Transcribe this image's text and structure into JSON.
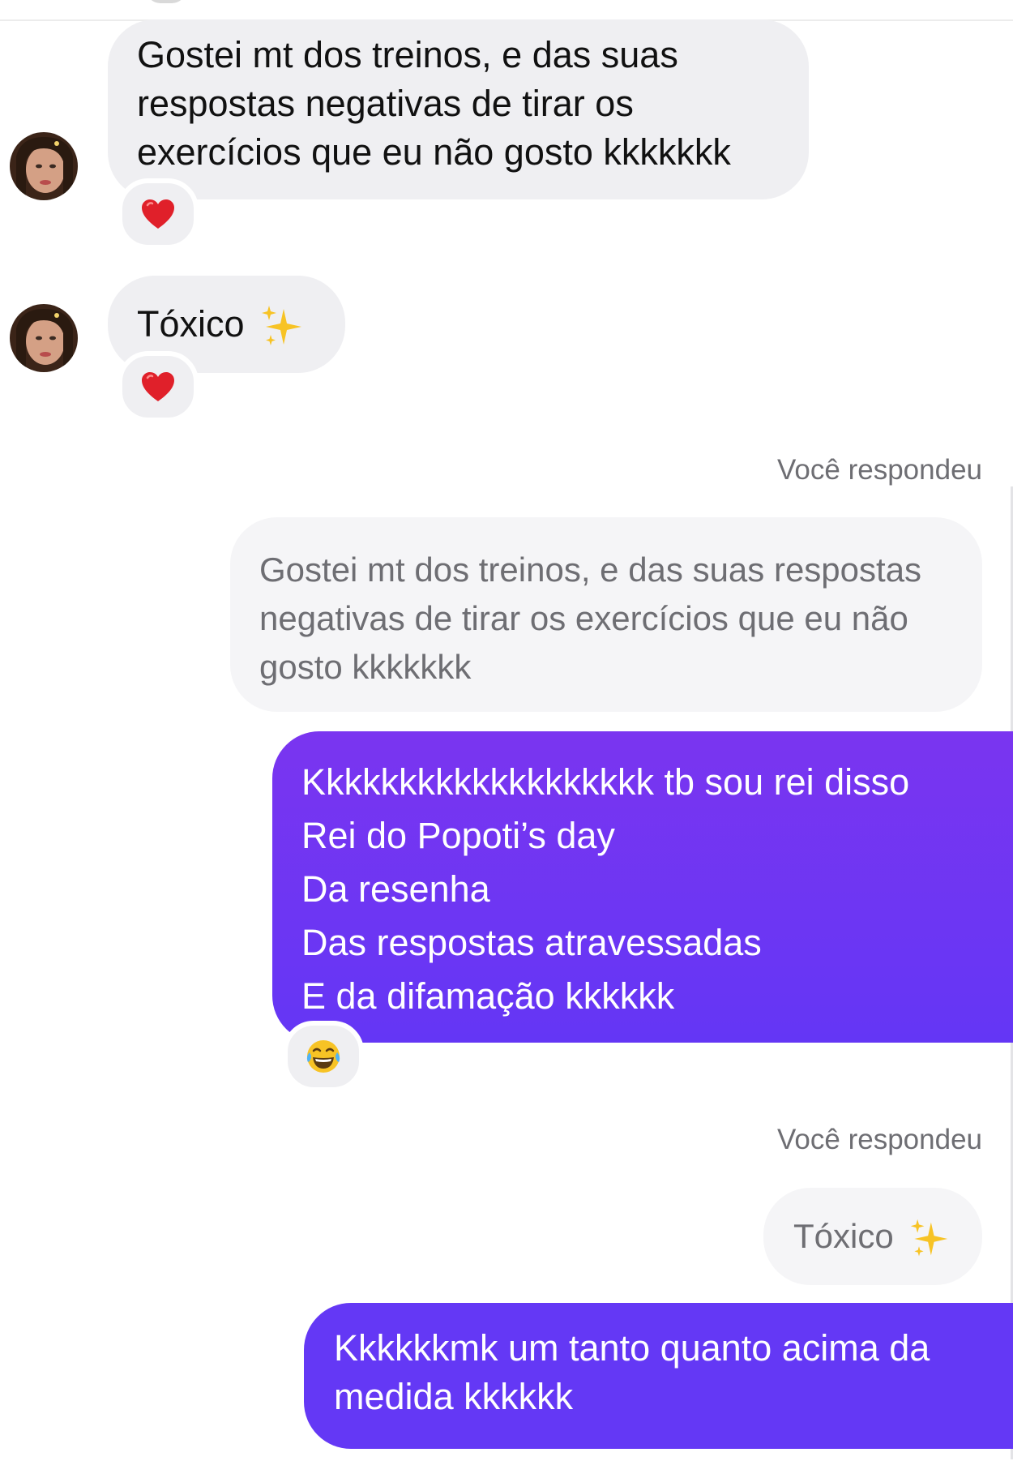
{
  "messages": {
    "m1": {
      "lines": [
        "Gostei mt dos treinos, e das suas",
        "respostas negativas de tirar os",
        "exercícios que eu não gosto kkkkkkk"
      ],
      "reaction_icon": "red-heart-emoji"
    },
    "m2": {
      "text": "Tóxico",
      "emoji_icon": "sparkles-emoji",
      "reaction_icon": "red-heart-emoji"
    },
    "reply1": {
      "label": "Você respondeu",
      "quote_lines": [
        "Gostei mt dos treinos, e das suas respostas",
        "negativas de tirar os exercícios que eu não",
        "gosto kkkkkkk"
      ],
      "lines": [
        "Kkkkkkkkkkkkkkkkkkk tb sou rei disso",
        "Rei do Popoti’s day",
        "Da resenha",
        "Das respostas atravessadas",
        "E da difamação kkkkkk"
      ],
      "reaction_icon": "laughing-tears-emoji"
    },
    "reply2": {
      "label": "Você respondeu",
      "quote_text": "Tóxico",
      "quote_emoji_icon": "sparkles-emoji",
      "lines": [
        "Kkkkkkmk um tanto quanto acima da",
        "medida kkkkkk"
      ]
    }
  },
  "colors": {
    "incoming_bubble": "#efeff2",
    "outgoing_bubble_top": "#7a35f0",
    "outgoing_bubble_bottom": "#6436f5",
    "secondary_text": "#6e6e73"
  }
}
